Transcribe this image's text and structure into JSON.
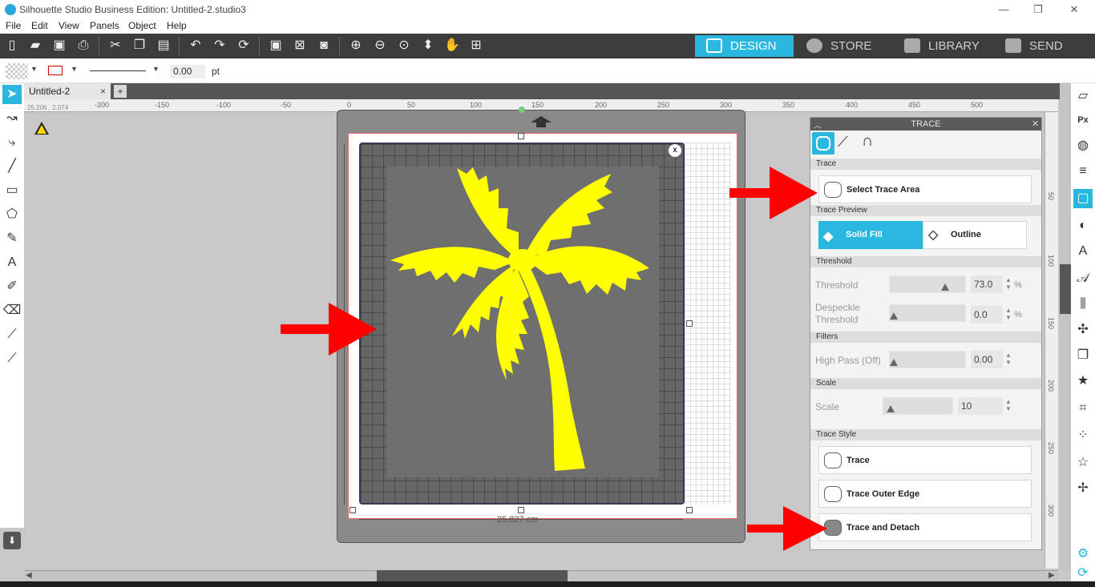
{
  "window": {
    "title": "Silhouette Studio Business Edition: Untitled-2.studio3",
    "controls": [
      "—",
      "❐",
      "✕"
    ]
  },
  "menu": [
    "File",
    "Edit",
    "View",
    "Panels",
    "Object",
    "Help"
  ],
  "nav_tabs": [
    {
      "label": "DESIGN",
      "icon": "grid-icon"
    },
    {
      "label": "STORE",
      "icon": "store-icon"
    },
    {
      "label": "LIBRARY",
      "icon": "library-icon"
    },
    {
      "label": "SEND",
      "icon": "send-icon"
    }
  ],
  "propbar": {
    "line_width": "0.00",
    "unit": "pt"
  },
  "doc_tab": {
    "label": "Untitled-2",
    "close": "×",
    "add": "+"
  },
  "ruler": {
    "coords": "25.206 , 2.074",
    "labels": [
      "-200",
      "-150",
      "-100",
      "-50",
      "0",
      "50",
      "100",
      "150",
      "200",
      "250",
      "300",
      "350",
      "400",
      "450",
      "500"
    ],
    "v_labels": [
      "50",
      "100",
      "150",
      "200",
      "250",
      "300"
    ]
  },
  "mat": {
    "width_label": "25.827 cm",
    "close": "x"
  },
  "trace_panel": {
    "title": "TRACE",
    "close": "✕",
    "sections": {
      "trace": "Trace",
      "preview": "Trace Preview",
      "threshold": "Threshold",
      "filters": "Filters",
      "scale": "Scale",
      "style": "Trace Style"
    },
    "select_area": "Select Trace Area",
    "preview_options": [
      "Solid Fill",
      "Outline"
    ],
    "threshold_label": "Threshold",
    "threshold_value": "73.0",
    "threshold_level": 0.73,
    "despeckle_label_1": "Despeckle",
    "despeckle_label_2": "Threshold",
    "despeckle_value": "0.0",
    "despeckle_level": 0.0,
    "percent": "%",
    "highpass_label": "High Pass (Off)",
    "highpass_value": "0.00",
    "highpass_level": 0.0,
    "scale_label": "Scale",
    "scale_value": "10",
    "scale_level": 0.1,
    "style_buttons": [
      "Trace",
      "Trace Outer Edge",
      "Trace and Detach"
    ]
  },
  "colors": {
    "accent": "#29b7df",
    "palm": "#ffff00",
    "arrow": "#ff0000",
    "toolbar": "#3c3c3c"
  }
}
